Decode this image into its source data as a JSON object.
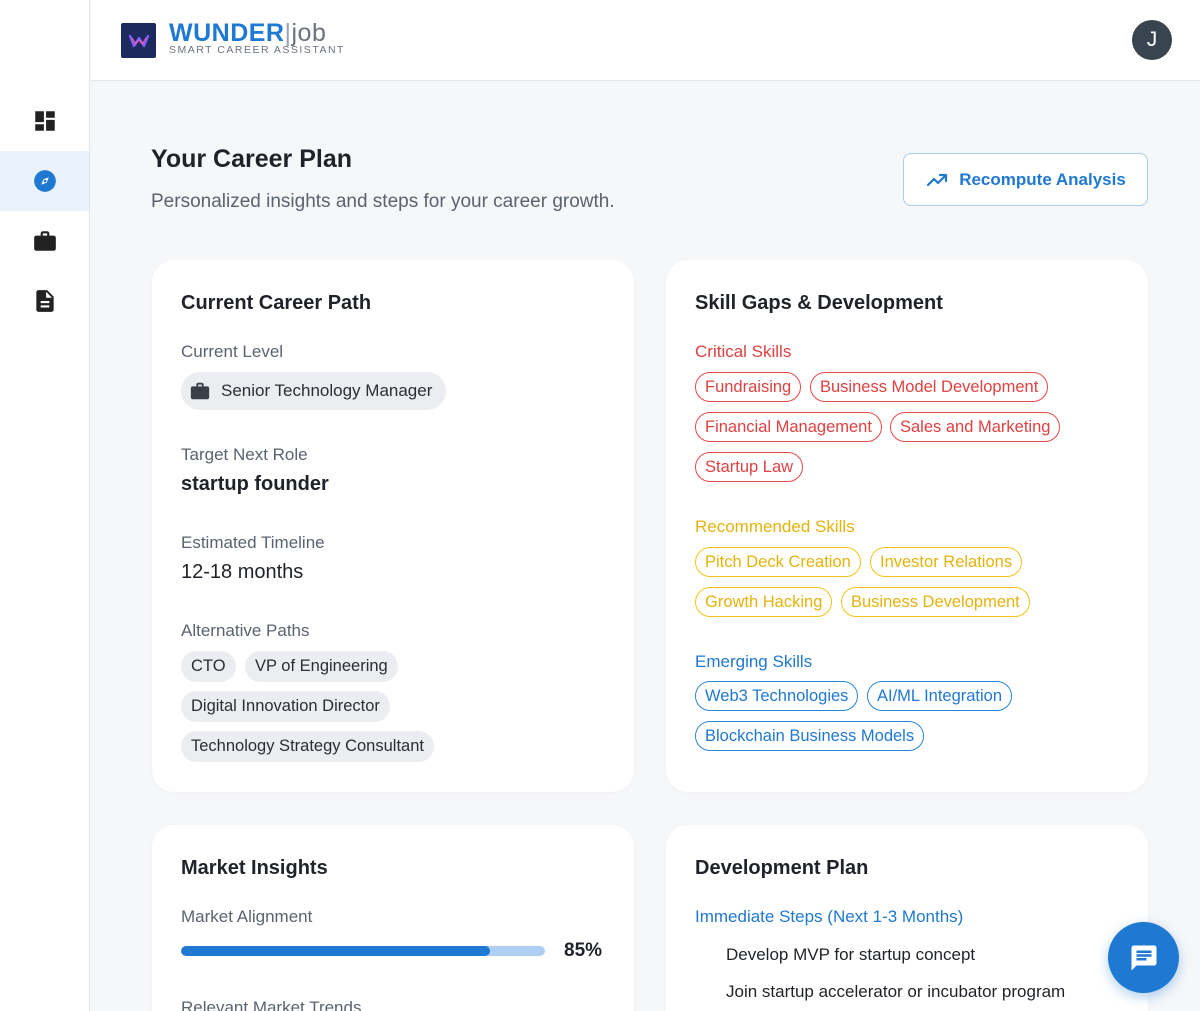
{
  "brand": {
    "name_bold": "WUNDER",
    "name_sep": "|",
    "name_light": "job",
    "tagline": "SMART CAREER ASSISTANT"
  },
  "user": {
    "avatar_initial": "J"
  },
  "sidebar": {
    "items": [
      {
        "icon": "dashboard-icon"
      },
      {
        "icon": "compass-icon",
        "active": true
      },
      {
        "icon": "briefcase-icon"
      },
      {
        "icon": "document-icon"
      }
    ]
  },
  "page": {
    "title": "Your Career Plan",
    "subtitle": "Personalized insights and steps for your career growth.",
    "recompute_label": "Recompute Analysis"
  },
  "career_path": {
    "title": "Current Career Path",
    "current_level_label": "Current Level",
    "current_level": "Senior Technology Manager",
    "target_label": "Target Next Role",
    "target": "startup founder",
    "timeline_label": "Estimated Timeline",
    "timeline": "12-18 months",
    "alt_label": "Alternative Paths",
    "alternatives": [
      "CTO",
      "VP of Engineering",
      "Digital Innovation Director",
      "Technology Strategy Consultant"
    ]
  },
  "skills": {
    "title": "Skill Gaps & Development",
    "critical_label": "Critical Skills",
    "critical": [
      "Fundraising",
      "Business Model Development",
      "Financial Management",
      "Sales and Marketing",
      "Startup Law"
    ],
    "recommended_label": "Recommended Skills",
    "recommended": [
      "Pitch Deck Creation",
      "Investor Relations",
      "Growth Hacking",
      "Business Development"
    ],
    "emerging_label": "Emerging Skills",
    "emerging": [
      "Web3 Technologies",
      "AI/ML Integration",
      "Blockchain Business Models"
    ]
  },
  "market": {
    "title": "Market Insights",
    "alignment_label": "Market Alignment",
    "alignment_value": 0.85,
    "alignment_text": "85%",
    "trends_label": "Relevant Market Trends"
  },
  "development": {
    "title": "Development Plan",
    "immediate_label": "Immediate Steps (Next 1-3 Months)",
    "immediate_steps": [
      "Develop MVP for startup concept",
      "Join startup accelerator or incubator program"
    ]
  },
  "colors": {
    "accent": "#1f78d1",
    "critical": "#e04040",
    "recommended": "#e4b30c",
    "emerging": "#1f78d1"
  }
}
